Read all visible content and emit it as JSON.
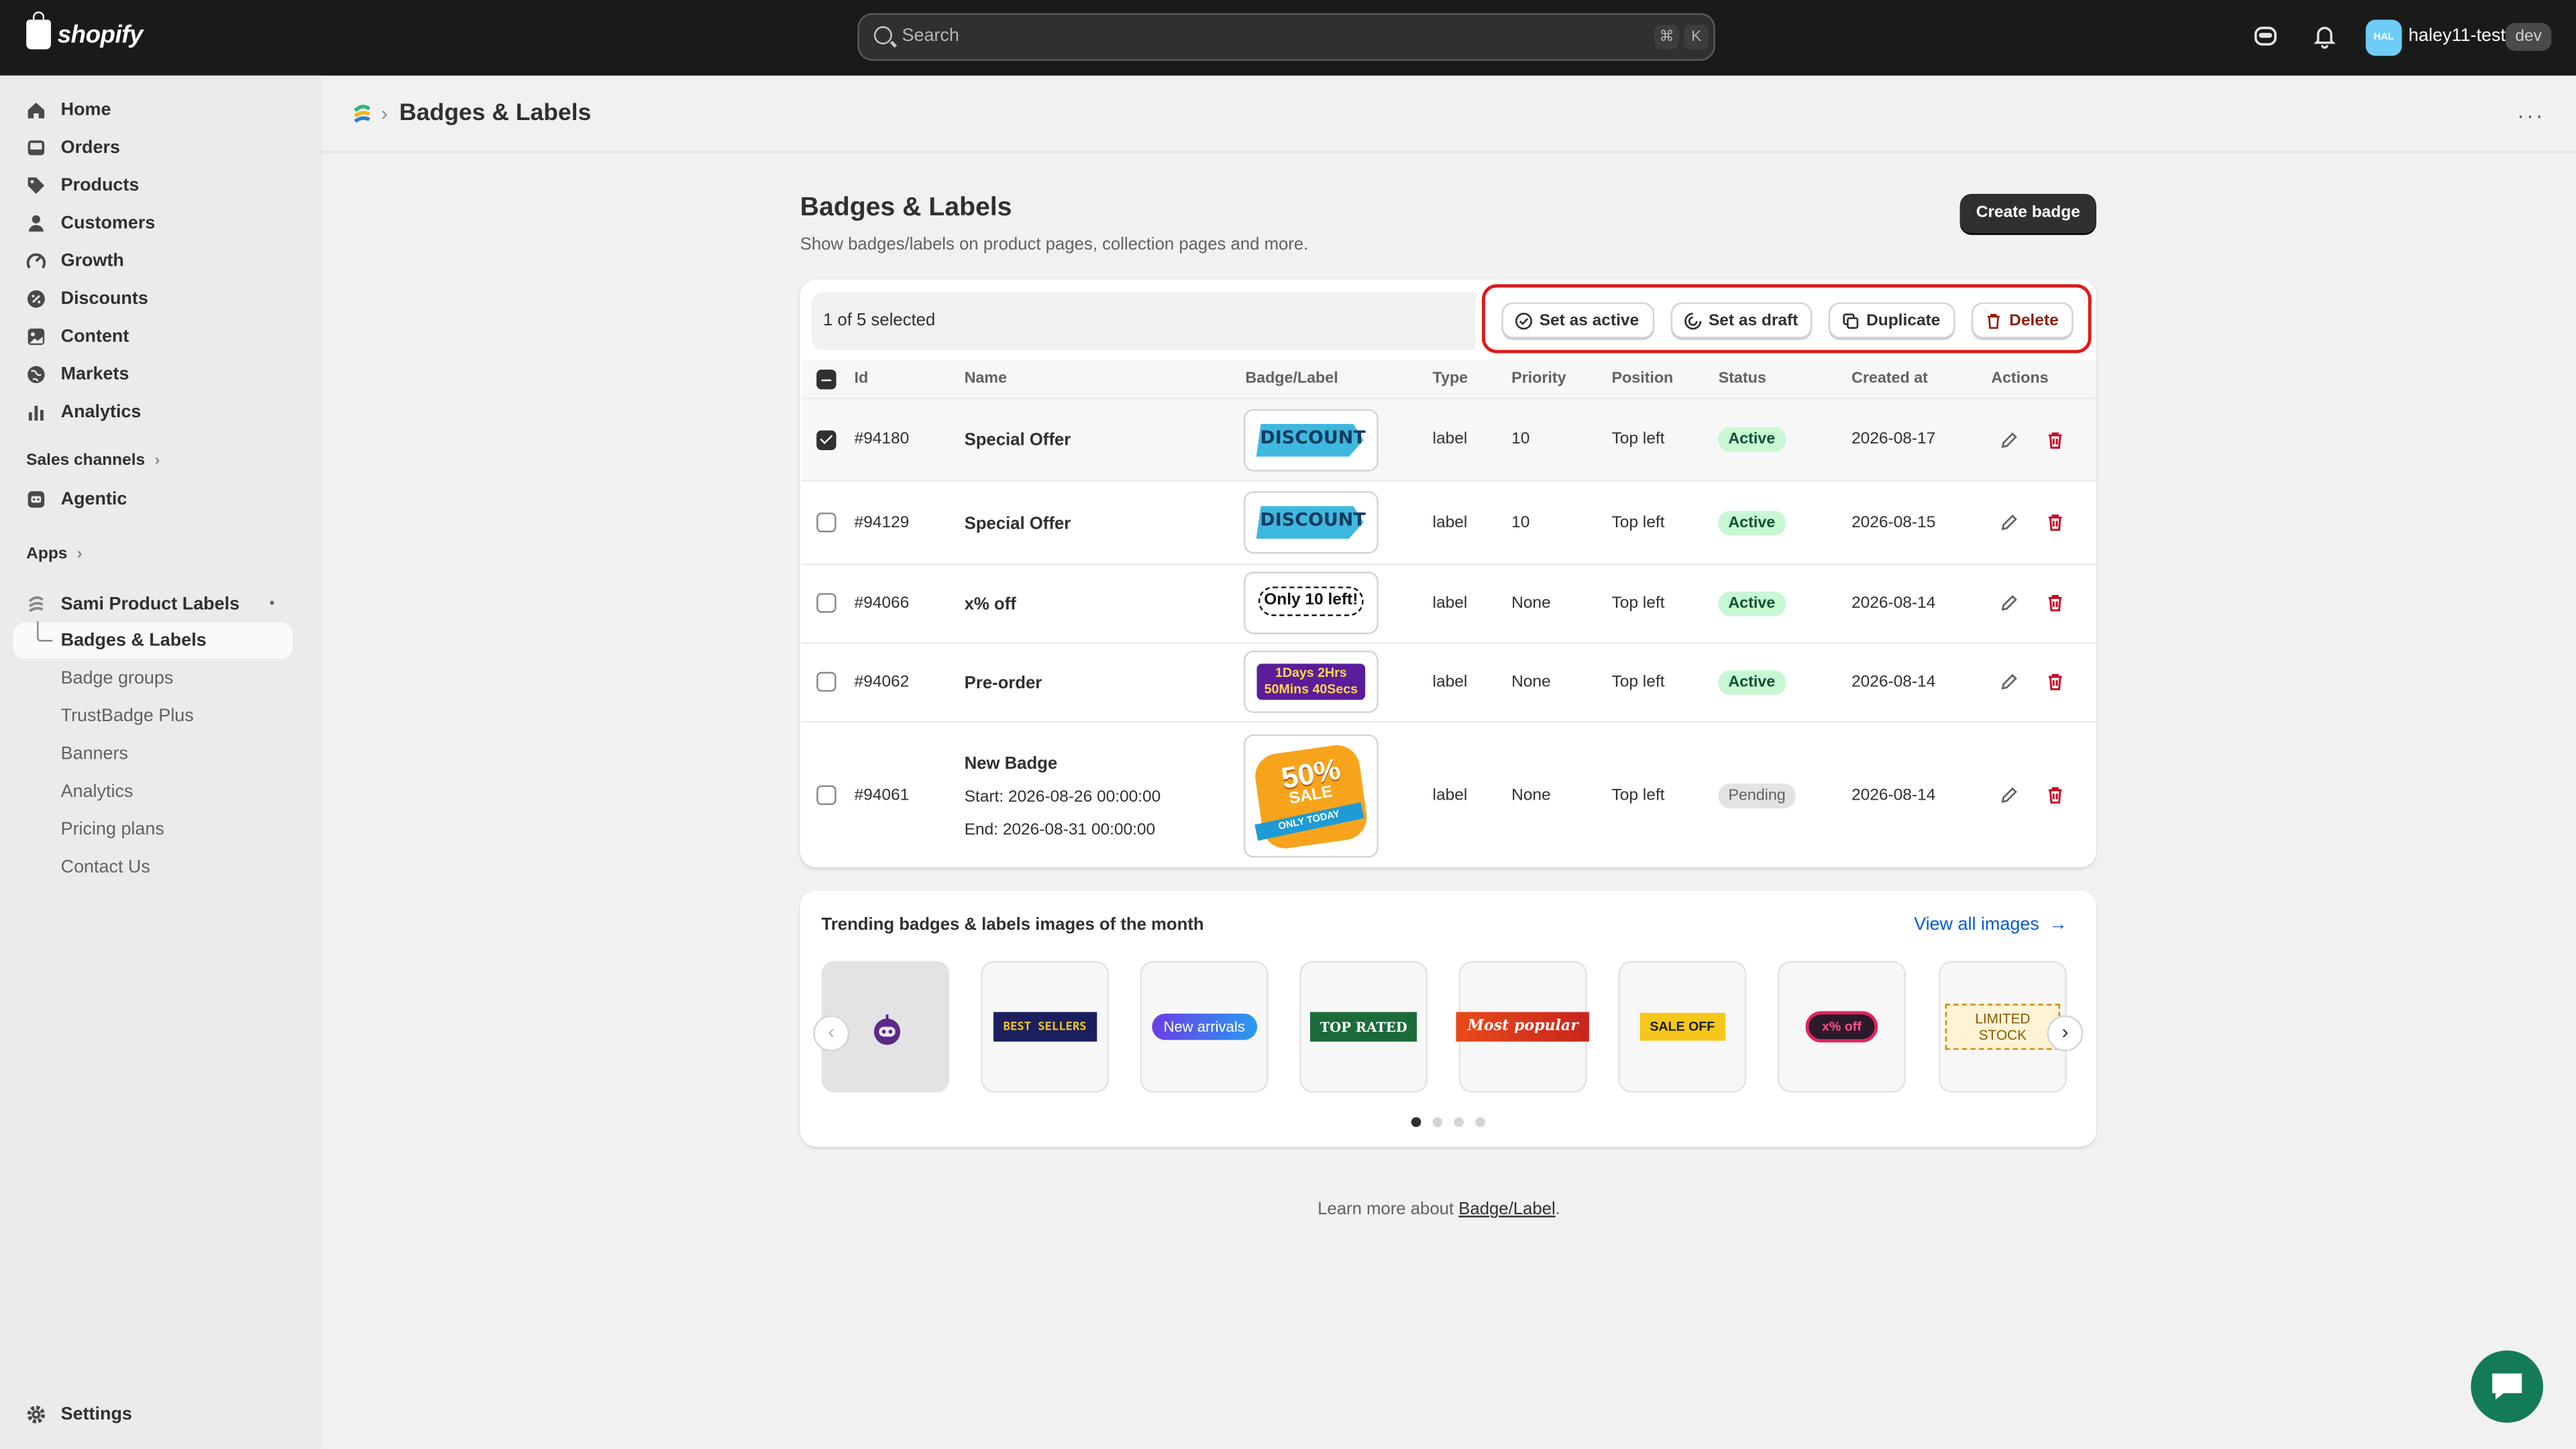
{
  "topbar": {
    "logo_text": "shopify",
    "search_placeholder": "Search",
    "shortcut_key1": "⌘",
    "shortcut_key2": "K",
    "avatar_initials": "HAL",
    "store_name": "haley11-test",
    "env_badge": "dev"
  },
  "sidebar": {
    "items": [
      {
        "label": "Home",
        "icon": "home-icon"
      },
      {
        "label": "Orders",
        "icon": "inbox-icon"
      },
      {
        "label": "Products",
        "icon": "tag-icon"
      },
      {
        "label": "Customers",
        "icon": "person-icon"
      },
      {
        "label": "Growth",
        "icon": "growth-icon"
      },
      {
        "label": "Discounts",
        "icon": "discount-icon"
      },
      {
        "label": "Content",
        "icon": "content-icon"
      },
      {
        "label": "Markets",
        "icon": "globe-icon"
      },
      {
        "label": "Analytics",
        "icon": "bar-chart-icon"
      }
    ],
    "sales_channels_title": "Sales channels",
    "agentic_label": "Agentic",
    "apps_title": "Apps",
    "app_name": "Sami Product Labels",
    "app_subitems": [
      "Badges & Labels",
      "Badge groups",
      "TrustBadge Plus",
      "Banners",
      "Analytics",
      "Pricing plans",
      "Contact Us"
    ],
    "settings_label": "Settings"
  },
  "page": {
    "breadcrumb_title": "Badges & Labels",
    "more_label": "···",
    "title": "Badges & Labels",
    "subtitle": "Show badges/labels on product pages, collection pages and more.",
    "create_button": "Create badge",
    "selection_text": "1 of 5 selected",
    "bulk_actions": {
      "set_active": "Set as active",
      "set_draft": "Set as draft",
      "duplicate": "Duplicate",
      "delete": "Delete"
    },
    "columns": [
      "Id",
      "Name",
      "Badge/Label",
      "Type",
      "Priority",
      "Position",
      "Status",
      "Created at",
      "Actions"
    ],
    "rows": [
      {
        "id": "#94180",
        "name": "Special Offer",
        "badge": "DISCOUNT",
        "type": "label",
        "priority": "10",
        "position": "Top left",
        "status": "Active",
        "created": "2026-08-17",
        "checked": true
      },
      {
        "id": "#94129",
        "name": "Special Offer",
        "badge": "DISCOUNT",
        "type": "label",
        "priority": "10",
        "position": "Top left",
        "status": "Active",
        "created": "2026-08-15",
        "checked": false
      },
      {
        "id": "#94066",
        "name": "x% off",
        "badge": "Only 10 left!",
        "type": "label",
        "priority": "None",
        "position": "Top left",
        "status": "Active",
        "created": "2026-08-14",
        "checked": false
      },
      {
        "id": "#94062",
        "name": "Pre-order",
        "badge": "1Days 2Hrs 50Mins 40Secs",
        "type": "label",
        "priority": "None",
        "position": "Top left",
        "status": "Active",
        "created": "2026-08-14",
        "checked": false
      },
      {
        "id": "#94061",
        "name": "New Badge",
        "start": "Start: 2026-08-26 00:00:00",
        "end": "End: 2026-08-31 00:00:00",
        "badge_big": "50%",
        "badge_mid": "SALE",
        "badge_small": "ONLY TODAY",
        "type": "label",
        "priority": "None",
        "position": "Top left",
        "status": "Pending",
        "created": "2026-08-14",
        "checked": false
      }
    ],
    "trending_title": "Trending badges & labels images of the month",
    "view_all": "View all images",
    "trending_tiles": [
      "BEST SELLERS",
      "New arrivals",
      "TOP RATED",
      "Most popular",
      "SALE OFF",
      "x% off",
      "LIMITED STOCK"
    ],
    "carousel_page": 1,
    "carousel_pages": 4,
    "learn_prefix": "Learn more about ",
    "learn_link": "Badge/Label",
    "learn_suffix": "."
  },
  "colors": {
    "topbar_bg": "#1a1a1a",
    "highlight_border": "#e01a1a",
    "active_pill": "#c8f7d4",
    "link": "#005bd3",
    "delete_red": "#c70a24",
    "chat_button": "#137a5a"
  }
}
